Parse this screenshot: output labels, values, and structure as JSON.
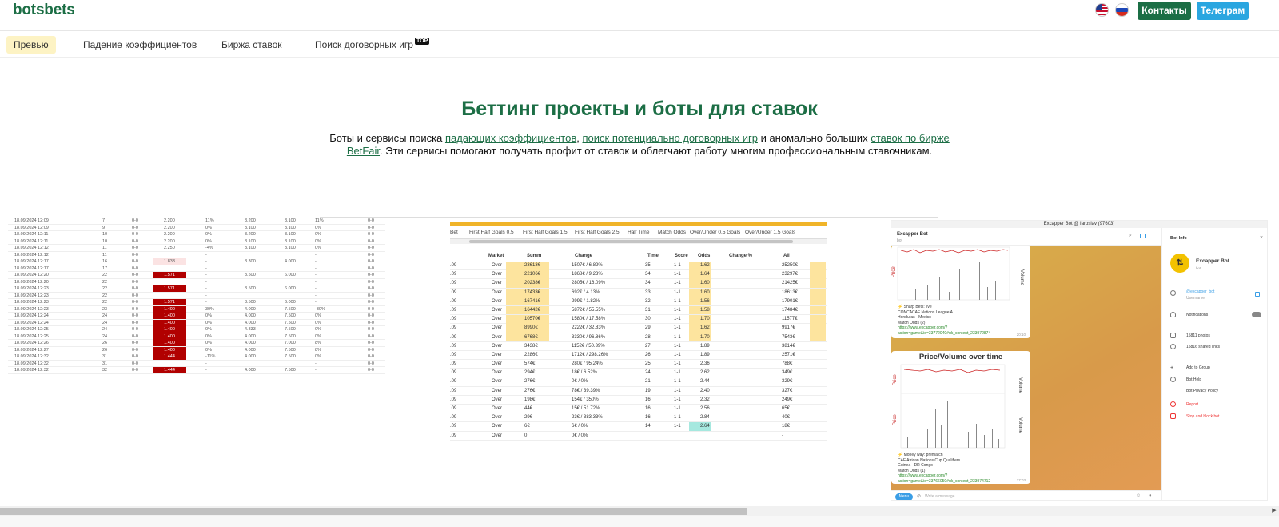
{
  "brand": {
    "logo": "botsbets",
    "accent": "#1c6e45"
  },
  "header": {
    "contacts": "Контакты",
    "telegram": "Телеграм",
    "flags": [
      "us-flag-icon",
      "ru-flag-icon"
    ]
  },
  "nav": {
    "items": [
      "Превью",
      "Падение коэффициентов",
      "Биржа ставок",
      "Поиск договорных игр"
    ],
    "badge": "TOP"
  },
  "hero": {
    "title": "Беттинг проекты и боты для ставок",
    "desc_1": "Боты и сервисы поиска ",
    "link_1": "падающих коэффициентов",
    "desc_2": ", ",
    "link_2": "поиск потенциально договорных игр",
    "desc_3": " и аномально больших ",
    "link_3": "ставок по бирже BetFair",
    "desc_4": ". Эти сервисы помогают получать профит от ставок и облегчают работу многим профессиональным ставочникам."
  },
  "panel1": {
    "rows": [
      [
        "18.09.2024 12:09",
        "7",
        "0-0",
        "2.200",
        "11%",
        "3.200",
        "3.100",
        "11%",
        "0-0"
      ],
      [
        "18.09.2024 12:09",
        "9",
        "0-0",
        "2.200",
        "0%",
        "3.100",
        "3.100",
        "0%",
        "0-0"
      ],
      [
        "18.09.2024 12:11",
        "10",
        "0-0",
        "2.200",
        "0%",
        "3.200",
        "3.100",
        "0%",
        "0-0"
      ],
      [
        "18.09.2024 12:11",
        "10",
        "0-0",
        "2.200",
        "0%",
        "3.100",
        "3.100",
        "0%",
        "0-0"
      ],
      [
        "18.09.2024 12:12",
        "11",
        "0-0",
        "2.250",
        "-4%",
        "3.100",
        "3.100",
        "0%",
        "0-0"
      ],
      [
        "18.09.2024 12:12",
        "11",
        "0-0",
        "",
        "-",
        "",
        "",
        "-",
        "0-0"
      ],
      [
        "18.09.2024 12:17",
        "16",
        "0-0",
        "1.833",
        "-",
        "3.300",
        "4.000",
        "-",
        "0-0"
      ],
      [
        "18.09.2024 12:17",
        "17",
        "0-0",
        "",
        "-",
        "",
        "",
        "-",
        "0-0"
      ],
      [
        "18.09.2024 12:20",
        "22",
        "0-0",
        "1.571",
        "-",
        "3.500",
        "6.000",
        "-",
        "0-0"
      ],
      [
        "18.09.2024 12:20",
        "22",
        "0-0",
        "",
        "-",
        "",
        "",
        "-",
        "0-0"
      ],
      [
        "18.09.2024 12:23",
        "22",
        "0-0",
        "1.571",
        "-",
        "3.500",
        "6.000",
        "-",
        "0-0"
      ],
      [
        "18.09.2024 12:23",
        "22",
        "0-0",
        "",
        "-",
        "",
        "",
        "-",
        "0-0"
      ],
      [
        "18.09.2024 12:23",
        "22",
        "0-0",
        "1.571",
        "-",
        "3.500",
        "6.000",
        "-",
        "0-0"
      ],
      [
        "18.09.2024 12:23",
        "23",
        "0-0",
        "1.400",
        "30%",
        "4.000",
        "7.500",
        "-30%",
        "0-0"
      ],
      [
        "18.09.2024 12:24",
        "24",
        "0-0",
        "1.400",
        "0%",
        "4.000",
        "7.500",
        "0%",
        "0-0"
      ],
      [
        "18.09.2024 12:24",
        "24",
        "0-0",
        "1.400",
        "0%",
        "4.000",
        "7.500",
        "0%",
        "0-0"
      ],
      [
        "18.09.2024 12:25",
        "24",
        "0-0",
        "1.400",
        "0%",
        "4.333",
        "7.500",
        "0%",
        "0-0"
      ],
      [
        "18.09.2024 12:25",
        "24",
        "0-0",
        "1.400",
        "0%",
        "4.000",
        "7.500",
        "0%",
        "0-0"
      ],
      [
        "18.09.2024 12:26",
        "26",
        "0-0",
        "1.400",
        "0%",
        "4.000",
        "7.000",
        "8%",
        "0-0"
      ],
      [
        "18.09.2024 12:27",
        "26",
        "0-0",
        "1.400",
        "0%",
        "4.000",
        "7.500",
        "8%",
        "0-0"
      ],
      [
        "18.09.2024 12:32",
        "31",
        "0-0",
        "1.444",
        "-11%",
        "4.000",
        "7.500",
        "0%",
        "0-0"
      ],
      [
        "18.09.2024 12:32",
        "31",
        "0-0",
        "",
        "-",
        "",
        "",
        "-",
        "0-0"
      ],
      [
        "18.09.2024 12:32",
        "32",
        "0-0",
        "1.444",
        "-",
        "4.000",
        "7.500",
        "-",
        "0-0"
      ]
    ],
    "red_rows": [
      8,
      10,
      12,
      13,
      14,
      15,
      16,
      17,
      18,
      19,
      20,
      22
    ],
    "pink_rows": [
      6
    ]
  },
  "panel2": {
    "tabs": [
      "Bet",
      "First Half Goals 0.5",
      "First Half Goals 1.5",
      "First Half Goals 2.5",
      "Half Time",
      "Match Odds",
      "Over/Under 0.5 Goals",
      "Over/Under 1.5 Goals"
    ],
    "headers": [
      "Market",
      "Summ",
      "Change",
      "Time",
      "Score",
      "Odds",
      "Change %",
      "All"
    ],
    "rows": [
      [
        ".09",
        "Over",
        "23613€",
        "1507€ / 6.82%",
        "35",
        "1-1",
        "1.62",
        "",
        "25250€"
      ],
      [
        ".09",
        "Over",
        "22106€",
        "1868€ / 9.23%",
        "34",
        "1-1",
        "1.64",
        "",
        "23297€"
      ],
      [
        ".09",
        "Over",
        "20238€",
        "2805€ / 16.09%",
        "34",
        "1-1",
        "1.60",
        "",
        "21425€"
      ],
      [
        ".09",
        "Over",
        "17433€",
        "692€ / 4.13%",
        "33",
        "1-1",
        "1.60",
        "",
        "18613€"
      ],
      [
        ".09",
        "Over",
        "16741€",
        "299€ / 1.82%",
        "32",
        "1-1",
        "1.56",
        "",
        "17901€"
      ],
      [
        ".09",
        "Over",
        "16442€",
        "5872€ / 55.55%",
        "31",
        "1-1",
        "1.58",
        "",
        "17484€"
      ],
      [
        ".09",
        "Over",
        "10570€",
        "1580€ / 17.58%",
        "30",
        "1-1",
        "1.70",
        "",
        "11577€"
      ],
      [
        ".09",
        "Over",
        "8990€",
        "2222€ / 32.83%",
        "29",
        "1-1",
        "1.62",
        "",
        "9917€"
      ],
      [
        ".09",
        "Over",
        "6768€",
        "3330€ / 96.86%",
        "28",
        "1-1",
        "1.70",
        "",
        "7543€"
      ],
      [
        ".09",
        "Over",
        "3438€",
        "1152€ / 50.39%",
        "27",
        "1-1",
        "1.89",
        "",
        "3814€"
      ],
      [
        ".09",
        "Over",
        "2286€",
        "1712€ / 298.26%",
        "26",
        "1-1",
        "1.89",
        "",
        "2571€"
      ],
      [
        ".09",
        "Over",
        "574€",
        "280€ / 95.24%",
        "25",
        "1-1",
        "2.36",
        "",
        "788€"
      ],
      [
        ".09",
        "Over",
        "294€",
        "18€ / 6.52%",
        "24",
        "1-1",
        "2.62",
        "",
        "349€"
      ],
      [
        ".09",
        "Over",
        "276€",
        "0€ / 0%",
        "21",
        "1-1",
        "2.44",
        "",
        "329€"
      ],
      [
        ".09",
        "Over",
        "276€",
        "78€ / 39.39%",
        "19",
        "1-1",
        "2.40",
        "",
        "327€"
      ],
      [
        ".09",
        "Over",
        "198€",
        "154€ / 350%",
        "16",
        "1-1",
        "2.32",
        "",
        "249€"
      ],
      [
        ".09",
        "Over",
        "44€",
        "15€ / 51.72%",
        "16",
        "1-1",
        "2.56",
        "",
        "65€"
      ],
      [
        ".09",
        "Over",
        "29€",
        "23€ / 383.33%",
        "16",
        "1-1",
        "2.84",
        "",
        "40€"
      ],
      [
        ".09",
        "Over",
        "6€",
        "6€ / 0%",
        "14",
        "1-1",
        "2.64",
        "",
        "18€"
      ],
      [
        ".09",
        "Over",
        "0",
        "0€ / 0%",
        "",
        "",
        "",
        "",
        "-"
      ]
    ],
    "yellow_rows": 9,
    "green_row": 18
  },
  "panel3": {
    "window_title": "Excapper Bot @ Iaroslav (97603)",
    "chat_title": "Excapper Bot",
    "chat_sub": "bot",
    "chart_title": "Price/Volume over time",
    "axis_price": "Price",
    "axis_volume": "Volume",
    "msg1": [
      "⚡ Sharp Bets: live",
      "CONCACAF Nations League A",
      "Honduras - Mexico",
      "Match Odds (2)",
      "https://www.excapper.com/?",
      "action=game&id=33772040#uk_content_233972874"
    ],
    "msg1_time": "20:10",
    "msg2": [
      "⚡ Money way: prematch",
      "CAF African Nations Cup Qualifiers",
      "Guinea - DR Congo",
      "Match Odds (1)",
      "https://www.excapper.com/?",
      "action=game&id=33766050#uk_content_233974712"
    ],
    "msg2_time": "17:03",
    "menu": "Menu",
    "input_placeholder": "Write a message...",
    "side": {
      "title": "Bot Info",
      "name": "Excapper Bot",
      "sub": "bot",
      "username": "@excapper_bot",
      "username_label": "Username",
      "notifications": "Notifications",
      "photos": "15811 photos",
      "links": "15816 shared links",
      "add": "Add to Group",
      "help": "Bot Help",
      "privacy": "Bot Privacy Policy",
      "report": "Report",
      "stop": "Stop and block bot"
    }
  }
}
